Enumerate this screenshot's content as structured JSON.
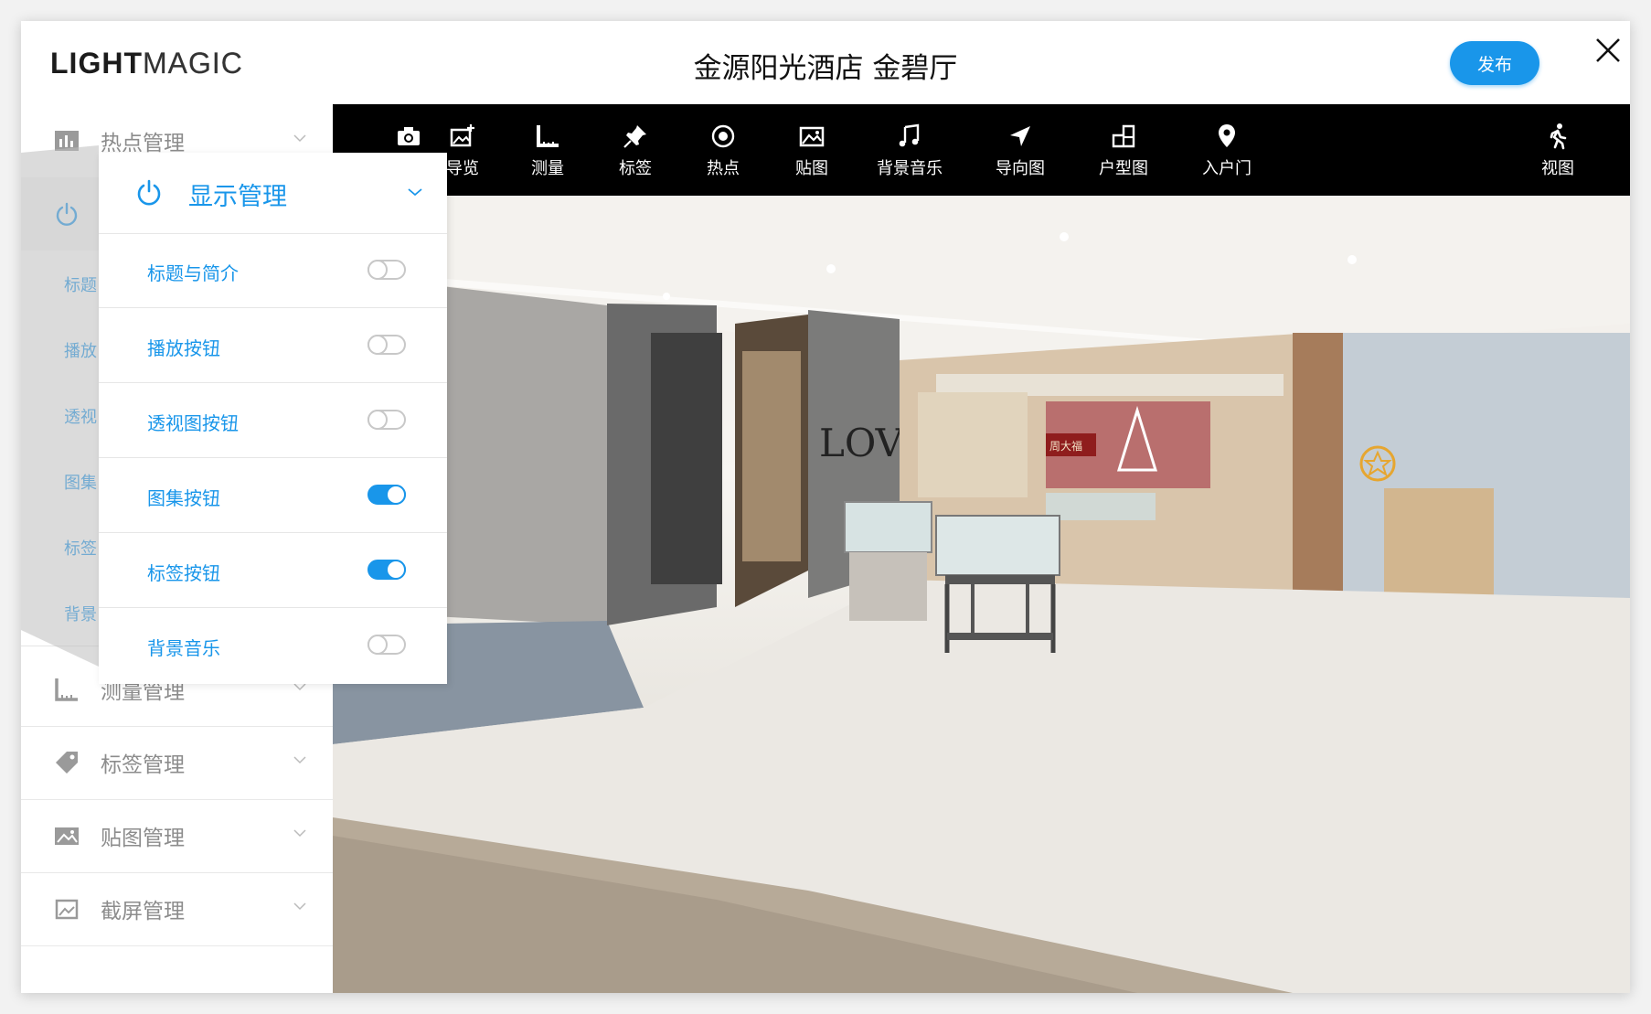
{
  "header": {
    "logo_bold": "LIGHT",
    "logo_light": "MAGIC",
    "title": "金源阳光酒店 金碧厅",
    "publish_label": "发布"
  },
  "sidebar": {
    "items": [
      {
        "label": "热点管理",
        "icon": "bar-chart-icon"
      },
      {
        "label": "测量管理",
        "icon": "ruler-icon"
      },
      {
        "label": "标签管理",
        "icon": "tag-icon"
      },
      {
        "label": "贴图管理",
        "icon": "image-icon"
      },
      {
        "label": "截屏管理",
        "icon": "screenshot-icon"
      }
    ],
    "partial_rows": [
      "标题",
      "播放",
      "透视",
      "图集",
      "标签",
      "背景"
    ]
  },
  "toolbar": {
    "items": [
      {
        "label": "",
        "icon": "camera-icon"
      },
      {
        "label": "导览",
        "icon": "guide-image-icon"
      },
      {
        "label": "测量",
        "icon": "measure-icon"
      },
      {
        "label": "标签",
        "icon": "pin-icon"
      },
      {
        "label": "热点",
        "icon": "hotspot-icon"
      },
      {
        "label": "贴图",
        "icon": "sticker-icon"
      },
      {
        "label": "背景音乐",
        "icon": "music-icon"
      },
      {
        "label": "导向图",
        "icon": "navigation-icon"
      },
      {
        "label": "户型图",
        "icon": "floorplan-icon"
      },
      {
        "label": "入户门",
        "icon": "location-pin-icon"
      },
      {
        "label": "视图",
        "icon": "walk-icon"
      }
    ]
  },
  "display_panel": {
    "title": "显示管理",
    "rows": [
      {
        "label": "标题与简介",
        "enabled": false
      },
      {
        "label": "播放按钮",
        "enabled": false
      },
      {
        "label": "透视图按钮",
        "enabled": false
      },
      {
        "label": "图集按钮",
        "enabled": true
      },
      {
        "label": "标签按钮",
        "enabled": true
      },
      {
        "label": "背景音乐",
        "enabled": false
      }
    ]
  },
  "scene": {
    "signage": [
      "LOVE",
      "周大福"
    ]
  },
  "colors": {
    "accent": "#1996ea",
    "toolbar_bg": "#000000",
    "muted_text": "#8c8c8c"
  }
}
